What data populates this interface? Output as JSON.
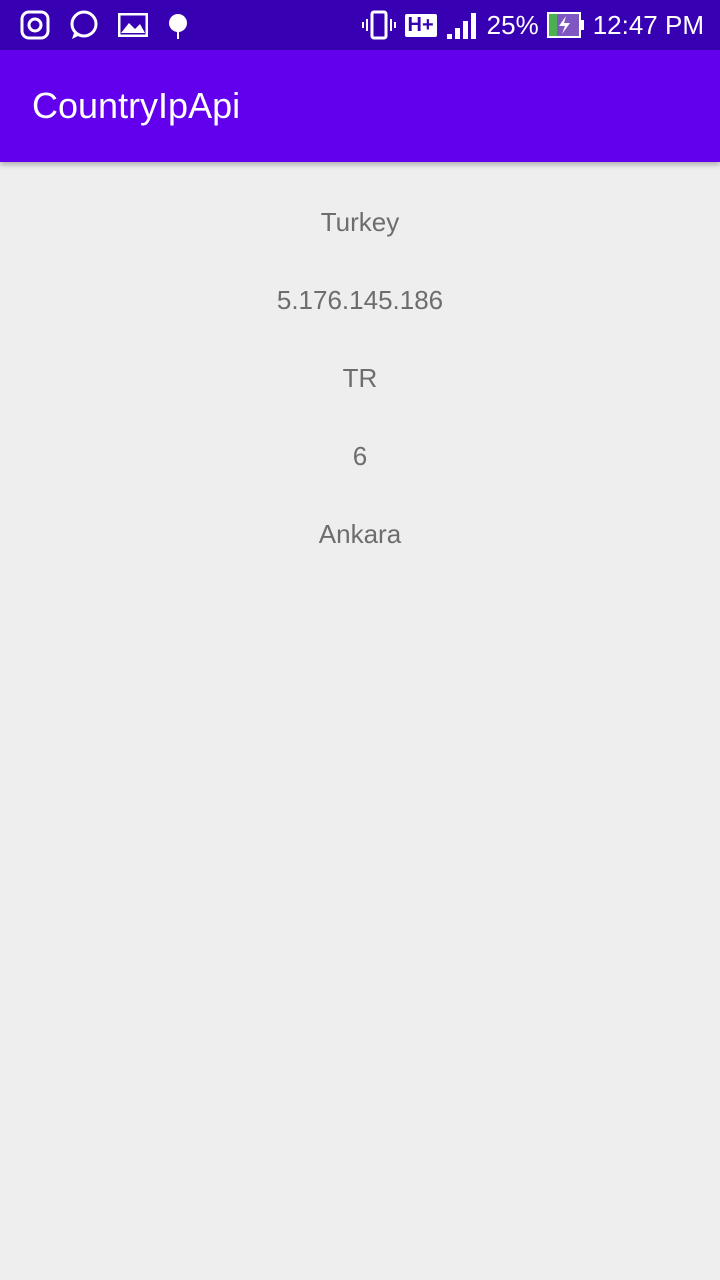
{
  "status_bar": {
    "left_icons": [
      "instagram-icon",
      "whatsapp-icon",
      "gallery-icon",
      "android-debug-icon"
    ],
    "right_icons": [
      "vibrate-icon",
      "hplus-network-icon",
      "signal-icon",
      "battery-charging-icon"
    ],
    "network_label": "H+",
    "battery": "25%",
    "time": "12:47 PM",
    "colors": {
      "background": "#3700b3"
    }
  },
  "app_bar": {
    "title": "CountryIpApi",
    "color": "#6200ee"
  },
  "content": {
    "country": "Turkey",
    "ip": "5.176.145.186",
    "country_code": "TR",
    "value": "6",
    "city": "Ankara"
  }
}
